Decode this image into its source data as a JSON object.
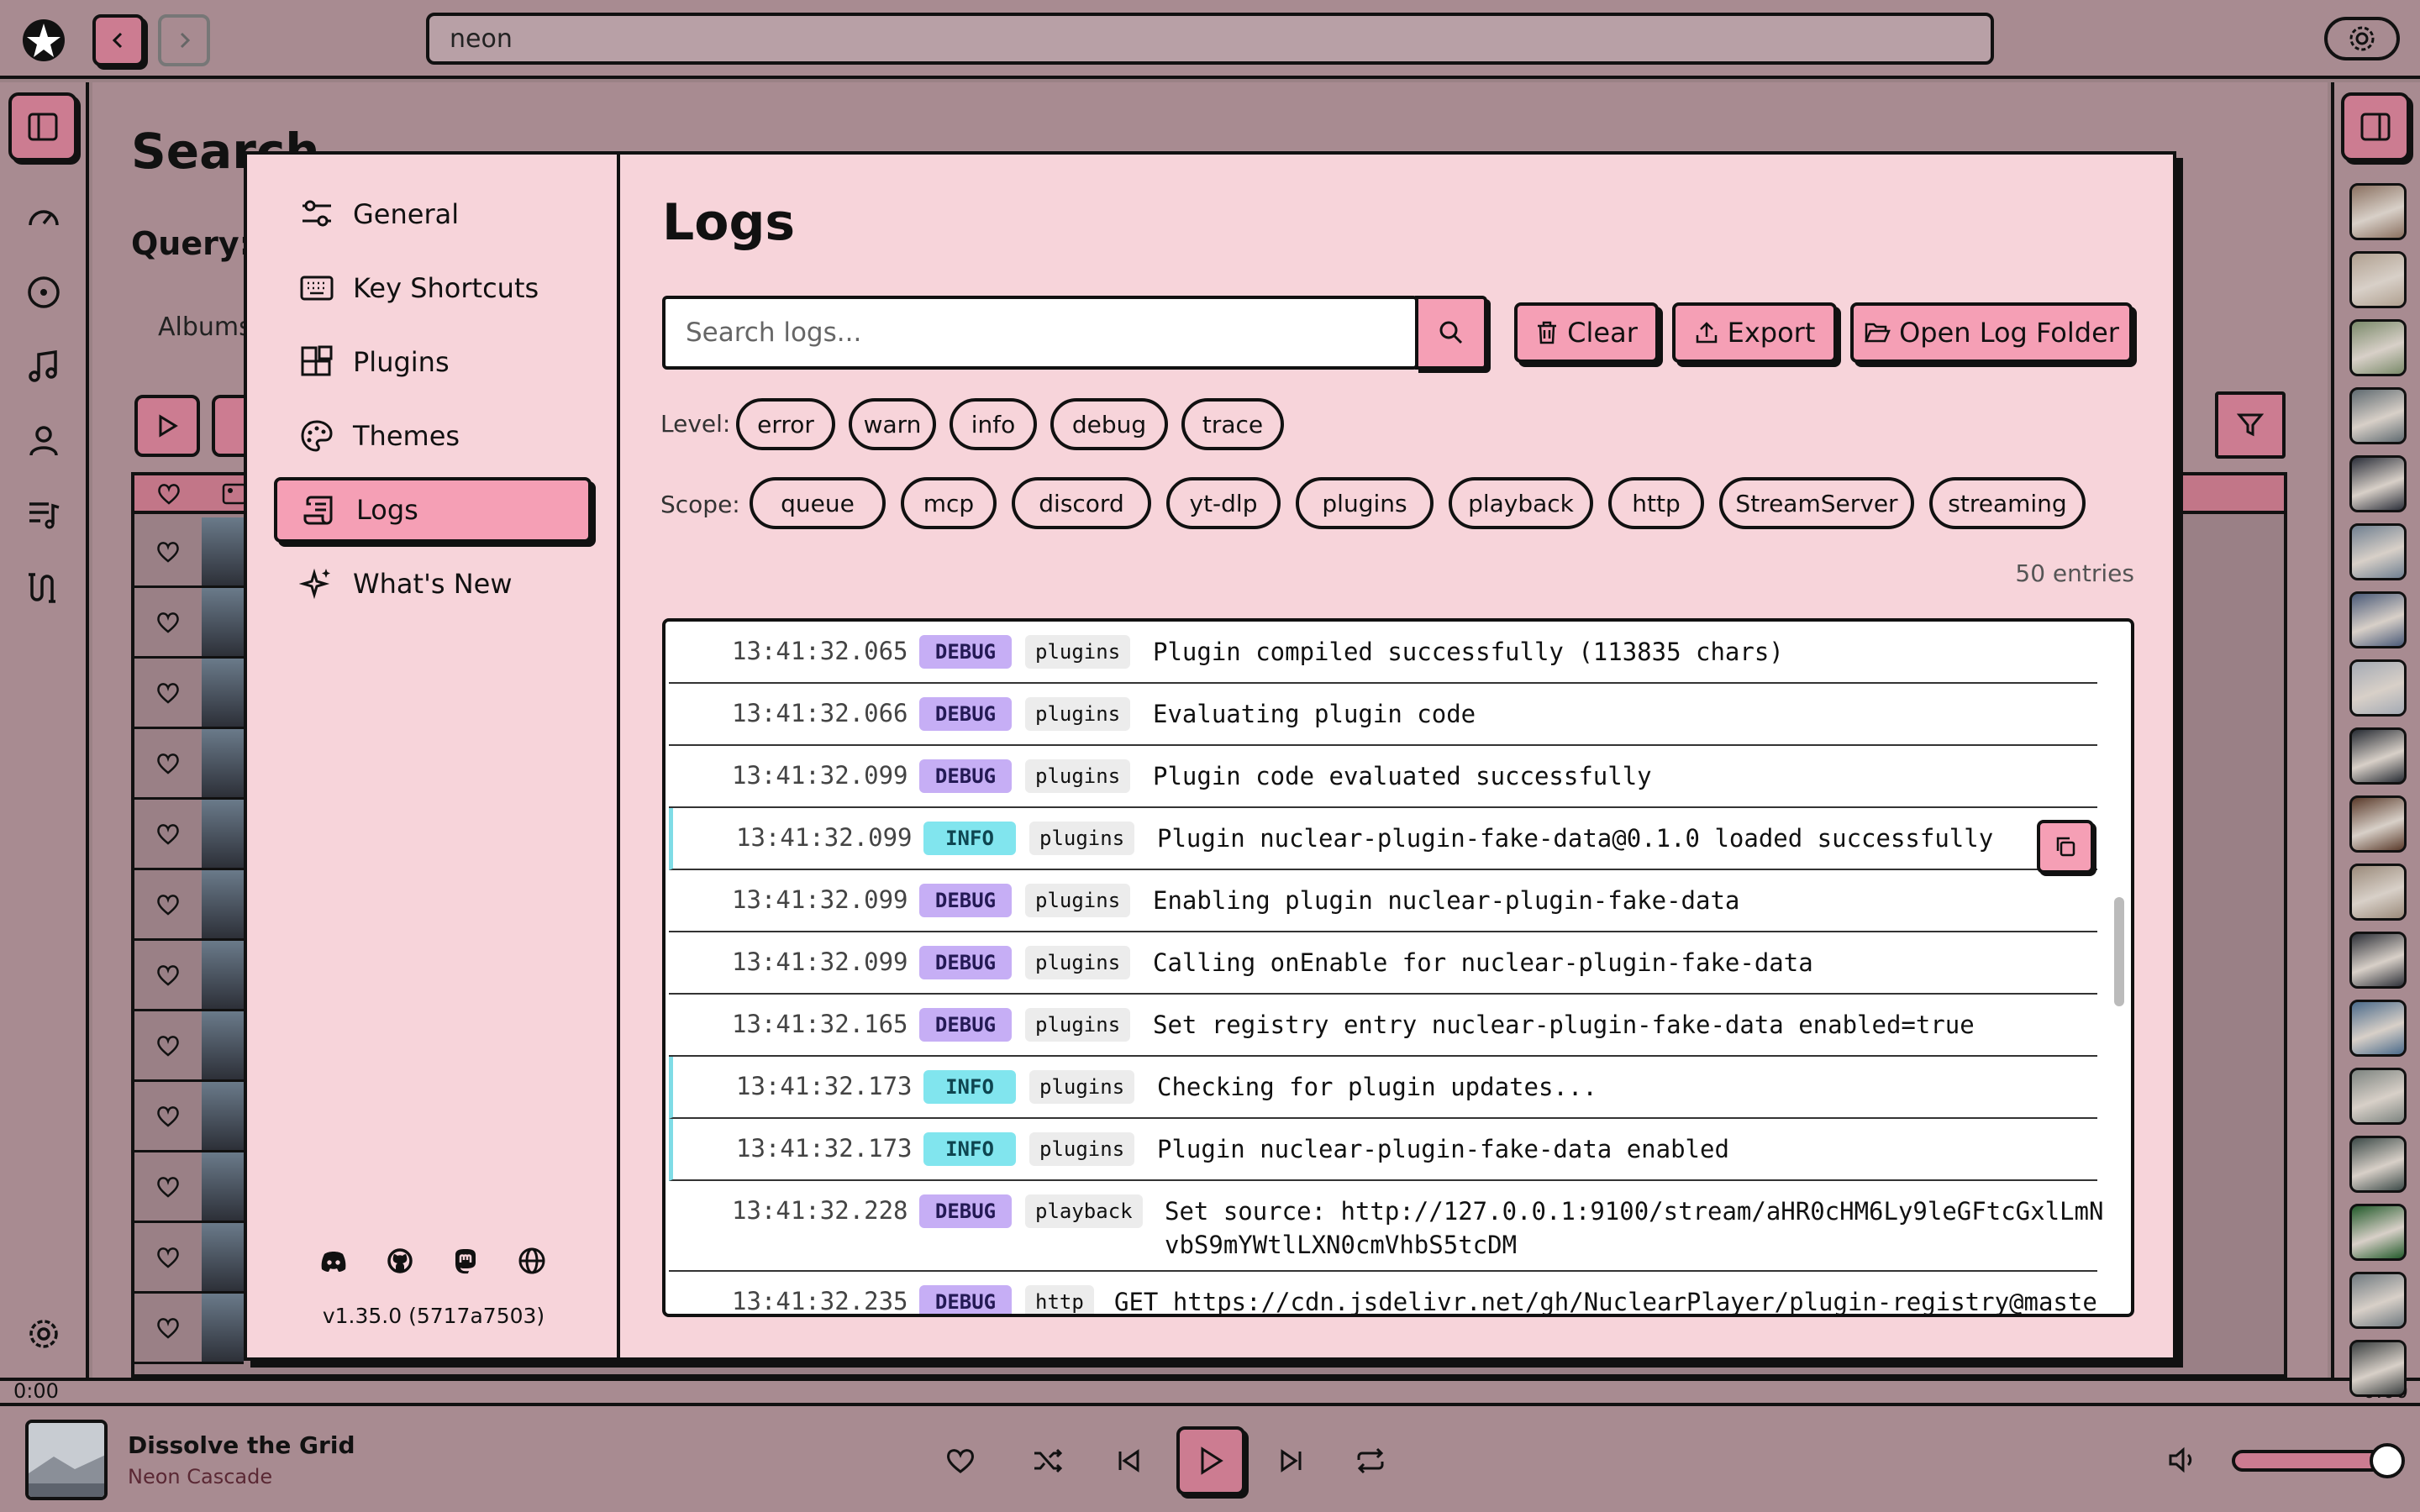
{
  "topbar": {
    "search_value": "neon"
  },
  "background": {
    "title": "Search",
    "query_label": "Query:",
    "tab_label": "Albums"
  },
  "settings": {
    "nav": [
      {
        "label": "General",
        "icon": "sliders-icon"
      },
      {
        "label": "Key Shortcuts",
        "icon": "keyboard-icon"
      },
      {
        "label": "Plugins",
        "icon": "puzzle-icon"
      },
      {
        "label": "Themes",
        "icon": "palette-icon"
      },
      {
        "label": "Logs",
        "icon": "scroll-icon",
        "active": true
      },
      {
        "label": "What's New",
        "icon": "sparkles-icon"
      }
    ],
    "version": "v1.35.0 (5717a7503)",
    "social_icons": [
      "discord-icon",
      "github-icon",
      "mastodon-icon",
      "globe-icon"
    ]
  },
  "logs": {
    "title": "Logs",
    "search_placeholder": "Search logs...",
    "buttons": {
      "clear": "Clear",
      "export": "Export",
      "open_folder": "Open Log Folder"
    },
    "level_label": "Level:",
    "levels": [
      "error",
      "warn",
      "info",
      "debug",
      "trace"
    ],
    "scope_label": "Scope:",
    "scopes": [
      "queue",
      "mcp",
      "discord",
      "yt-dlp",
      "plugins",
      "playback",
      "http",
      "StreamServer",
      "streaming"
    ],
    "entries_count": "50 entries",
    "rows": [
      {
        "time": "13:41:32.065",
        "level": "DEBUG",
        "scope": "plugins",
        "message": "Plugin compiled successfully (113835 chars)"
      },
      {
        "time": "13:41:32.066",
        "level": "DEBUG",
        "scope": "plugins",
        "message": "Evaluating plugin code"
      },
      {
        "time": "13:41:32.099",
        "level": "DEBUG",
        "scope": "plugins",
        "message": "Plugin code evaluated successfully"
      },
      {
        "time": "13:41:32.099",
        "level": "INFO",
        "scope": "plugins",
        "message": "Plugin nuclear-plugin-fake-data@0.1.0 loaded successfully"
      },
      {
        "time": "13:41:32.099",
        "level": "DEBUG",
        "scope": "plugins",
        "message": "Enabling plugin nuclear-plugin-fake-data"
      },
      {
        "time": "13:41:32.099",
        "level": "DEBUG",
        "scope": "plugins",
        "message": "Calling onEnable for nuclear-plugin-fake-data"
      },
      {
        "time": "13:41:32.165",
        "level": "DEBUG",
        "scope": "plugins",
        "message": "Set registry entry nuclear-plugin-fake-data enabled=true"
      },
      {
        "time": "13:41:32.173",
        "level": "INFO",
        "scope": "plugins",
        "message": "Checking for plugin updates..."
      },
      {
        "time": "13:41:32.173",
        "level": "INFO",
        "scope": "plugins",
        "message": "Plugin nuclear-plugin-fake-data enabled"
      },
      {
        "time": "13:41:32.228",
        "level": "DEBUG",
        "scope": "playback",
        "message": "Set source: http://127.0.0.1:9100/stream/aHR0cHM6Ly9leGFtcGxlLmN\nvbS9mYWtlLXN0cmVhbS5tcDM"
      },
      {
        "time": "13:41:32.235",
        "level": "DEBUG",
        "scope": "http",
        "message": "GET https://cdn.jsdelivr.net/gh/NuclearPlayer/plugin-registry@maste"
      }
    ]
  },
  "player": {
    "time_current": "0:00",
    "time_total": "0:00",
    "track_title": "Dissolve the Grid",
    "track_artist": "Neon Cascade",
    "volume": 0.9
  },
  "colors": {
    "accent": "#f59fb5",
    "panel": "#f7d4da",
    "debug": "#c6aef5",
    "info": "#81e5ee"
  }
}
